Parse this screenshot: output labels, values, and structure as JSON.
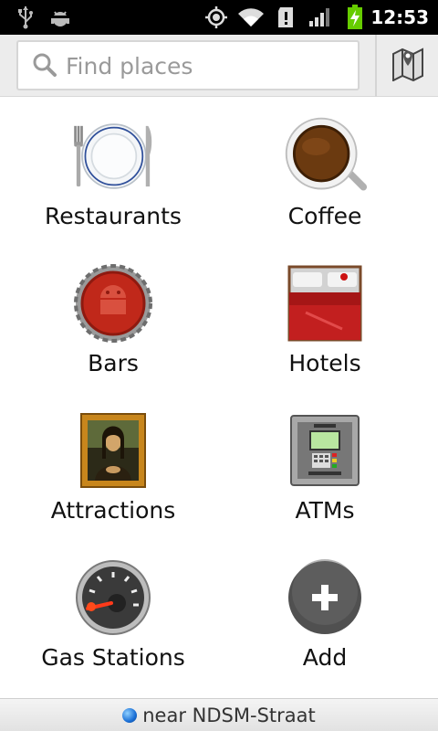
{
  "status_bar": {
    "time": "12:53",
    "icons": [
      "usb-icon",
      "android-debug-icon",
      "gps-icon",
      "wifi-icon",
      "sd-card-alert-icon",
      "cell-signal-icon",
      "battery-charging-icon"
    ]
  },
  "search": {
    "placeholder": "Find places"
  },
  "categories": [
    {
      "label": "Restaurants",
      "icon": "plate-cutlery-icon"
    },
    {
      "label": "Coffee",
      "icon": "coffee-cup-icon"
    },
    {
      "label": "Bars",
      "icon": "bottle-cap-icon"
    },
    {
      "label": "Hotels",
      "icon": "bed-icon"
    },
    {
      "label": "Attractions",
      "icon": "mona-lisa-painting-icon"
    },
    {
      "label": "ATMs",
      "icon": "atm-machine-icon"
    },
    {
      "label": "Gas Stations",
      "icon": "fuel-gauge-icon"
    },
    {
      "label": "Add",
      "icon": "add-plus-icon"
    }
  ],
  "footer": {
    "location_text": "near NDSM-Straat"
  },
  "colors": {
    "status_bar_bg": "#000000",
    "search_area_bg": "#ececec",
    "battery_green": "#66cc00",
    "location_dot": "#1a6fd6"
  }
}
